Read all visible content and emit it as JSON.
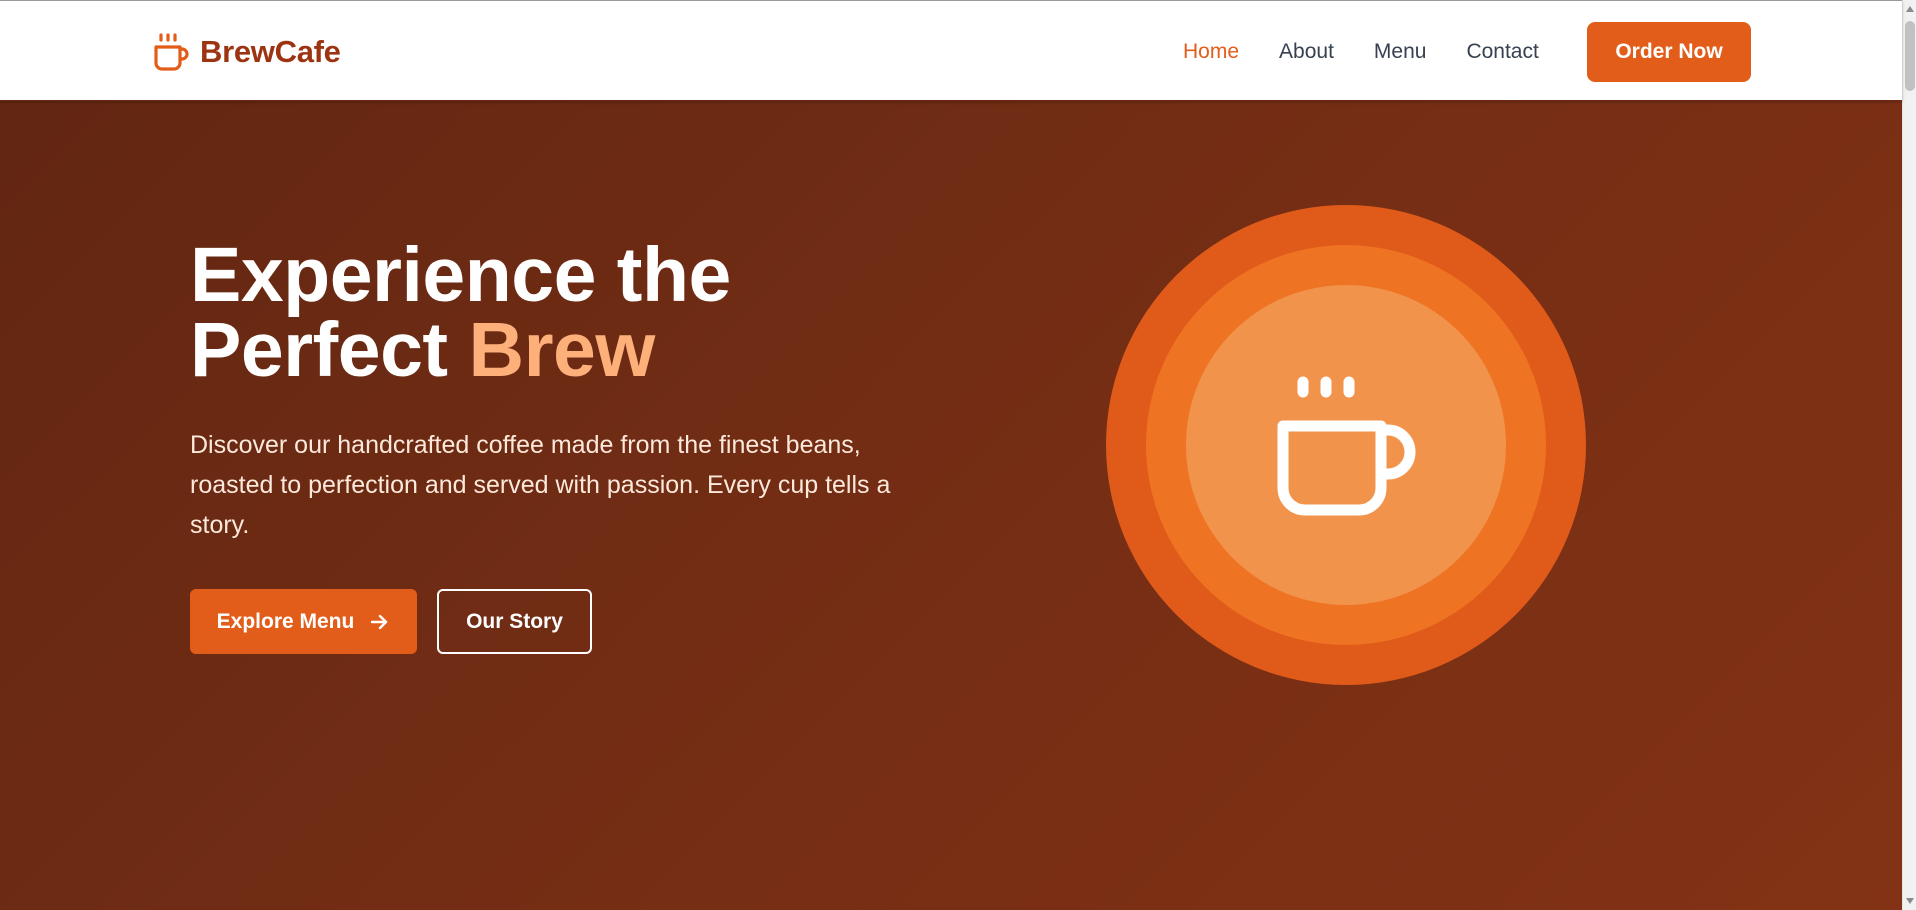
{
  "brand": {
    "name": "BrewCafe",
    "icon": "coffee-cup-icon",
    "color": "#9c3412"
  },
  "nav": {
    "links": [
      {
        "label": "Home",
        "active": true
      },
      {
        "label": "About",
        "active": false
      },
      {
        "label": "Menu",
        "active": false
      },
      {
        "label": "Contact",
        "active": false
      }
    ],
    "cta_label": "Order Now"
  },
  "hero": {
    "title_line1": "Experience the",
    "title_line2_prefix": "Perfect ",
    "title_accent": "Brew",
    "description": "Discover our handcrafted coffee made from the finest beans, roasted to perfection and served with passion. Every cup tells a story.",
    "primary_button": "Explore Menu",
    "primary_button_icon": "arrow-right-icon",
    "secondary_button": "Our Story",
    "illustration_icon": "coffee-cup-icon"
  },
  "colors": {
    "accent": "#e35d1a",
    "accent_light": "#fdb07a",
    "hero_background": "#6b2a14",
    "circle_outer": "#e05a1a",
    "circle_mid": "#ee7323",
    "circle_inner": "#f2934b"
  }
}
